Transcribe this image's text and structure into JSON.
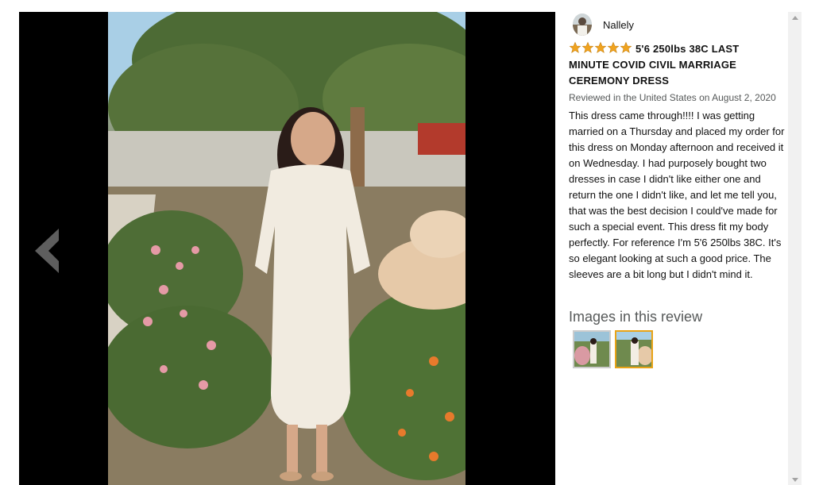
{
  "navigation": {
    "prev_icon": "chevron-left-icon"
  },
  "review": {
    "reviewer_name": "Nallely",
    "avatar_icon": "avatar-image",
    "rating": 5,
    "rating_max": 5,
    "star_color": "#f0a31f",
    "headline": "5'6 250lbs 38C LAST MINUTE COVID CIVIL MARRIAGE CEREMONY DRESS",
    "meta": "Reviewed in the United States on August 2, 2020",
    "body": "This dress came through!!!! I was getting married on a Thursday and placed my order for this dress on Monday afternoon and received it on Wednesday. I had purposely bought two dresses in case I didn't like either one and return the one I didn't like, and let me tell you, that was the best decision I could've made for such a special event. This dress fit my body perfectly. For reference I'm 5'6 250lbs 38C. It's so elegant looking at such a good price. The sleeves are a bit long but I didn't mind it."
  },
  "images_section": {
    "title": "Images in this review",
    "selected_index": 1,
    "selected_border_color": "#e8a317",
    "thumb_count": 2
  },
  "scrollbar": {
    "up_icon": "triangle-up-icon",
    "down_icon": "triangle-down-icon"
  }
}
